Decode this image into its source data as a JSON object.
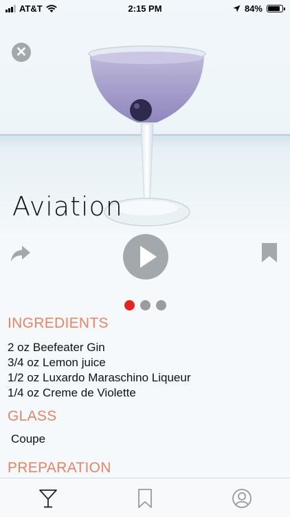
{
  "status_bar": {
    "carrier": "AT&T",
    "time": "2:15 PM",
    "battery": "84%",
    "battery_level": 0.84
  },
  "drink": {
    "name": "Aviation"
  },
  "pager": {
    "count": 3,
    "active_index": 0
  },
  "ingredients": {
    "title": "INGREDIENTS",
    "items": [
      "2 oz Beefeater Gin",
      "3/4 oz Lemon juice",
      "1/2 oz Luxardo Maraschino Liqueur",
      "1/4 oz Creme de Violette"
    ]
  },
  "glass": {
    "title": "GLASS",
    "value": "Coupe"
  },
  "preparation": {
    "title": "PREPARATION"
  },
  "colors": {
    "accent": "#e98463",
    "active_dot": "#e8231f",
    "icon_gray": "#a2a8ab"
  },
  "icons": {
    "close": "close-icon",
    "share": "share-icon",
    "play": "play-icon",
    "bookmark": "bookmark-icon",
    "tab_cocktails": "cocktail-glass-icon",
    "tab_saved": "bookmark-icon",
    "tab_profile": "profile-icon"
  }
}
